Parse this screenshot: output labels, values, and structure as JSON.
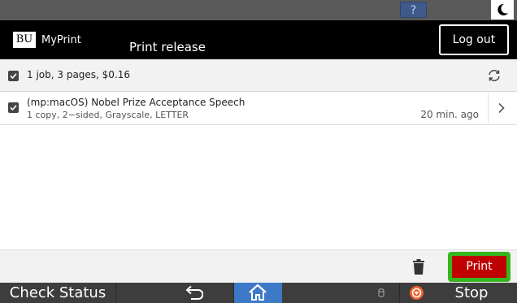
{
  "system_bar": {
    "help_label": "?"
  },
  "header": {
    "logo_mark": "BU",
    "app_name": "MyPrint",
    "title": "Print release",
    "logout_label": "Log out"
  },
  "summary": {
    "text": "1 job, 3 pages, $0.16",
    "checked": true
  },
  "jobs": [
    {
      "title": "(mp:macOS) Nobel Prize Acceptance Speech",
      "details": "1 copy, 2−sided, Grayscale, LETTER",
      "time": "20 min. ago",
      "checked": true
    }
  ],
  "actions": {
    "print_label": "Print"
  },
  "bottom_bar": {
    "check_status_label": "Check Status",
    "stop_label": "Stop"
  },
  "colors": {
    "header_bg": "#000000",
    "print_button": "#c00000",
    "print_highlight": "#35b51e",
    "home_button": "#3d79c7"
  },
  "icons": [
    "help-icon",
    "moon-icon",
    "checkbox-icon",
    "refresh-icon",
    "chevron-right-icon",
    "trash-icon",
    "back-arrow-icon",
    "home-icon",
    "data-led-icon",
    "stop-icon"
  ]
}
